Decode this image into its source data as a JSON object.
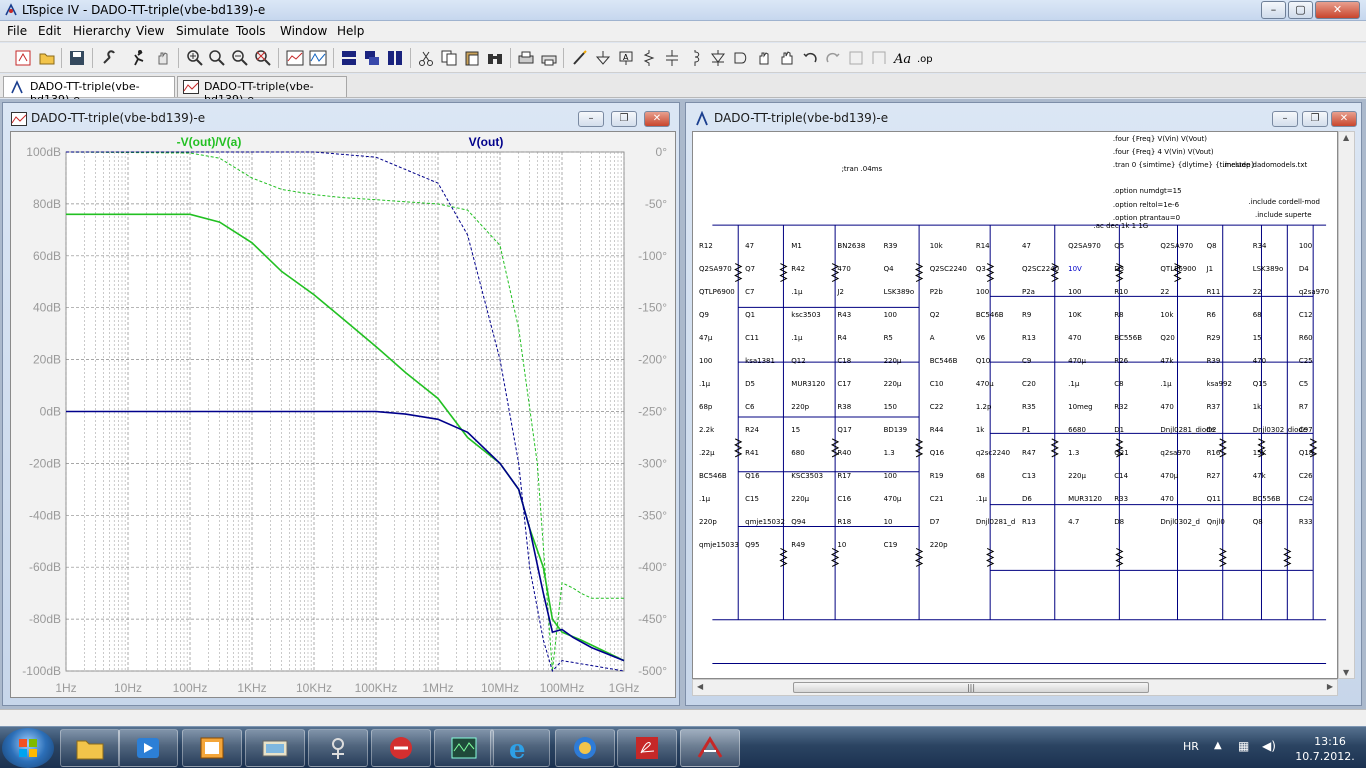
{
  "app": {
    "title": "LTspice IV - DADO-TT-triple(vbe-bd139)-e"
  },
  "menu": [
    "File",
    "Edit",
    "Hierarchy",
    "View",
    "Simulate",
    "Tools",
    "Window",
    "Help"
  ],
  "doc_tabs": [
    {
      "label": "DADO-TT-triple(vbe-bd139)-e",
      "kind": "schematic",
      "active": true
    },
    {
      "label": "DADO-TT-triple(vbe-bd139)-e",
      "kind": "waveform",
      "active": false
    }
  ],
  "waveform_window": {
    "title": "DADO-TT-triple(vbe-bd139)-e",
    "traces": [
      {
        "label": "-V(out)/V(a)",
        "color": "#22c022"
      },
      {
        "label": "V(out)",
        "color": "#00008b"
      }
    ]
  },
  "schematic_window": {
    "title": "DADO-TT-triple(vbe-bd139)-e",
    "directives": [
      ".four {Freq} V(Vin) V(Vout)",
      ".four {Freq} 4 V(Vin) V(Vout)",
      ".tran 0 {simtime} {dlytime} {timestep}",
      ".include dadomodels.txt",
      ".option numdgt=15",
      ".option reltol=1e-6",
      ".option ptrantau=0",
      ".include cordell-mod",
      ".include superte",
      ";tran .04ms",
      ".ac dec 1k 1 1G"
    ],
    "labels": [
      "R12",
      "47",
      "M1",
      "BN2638",
      "R39",
      "10k",
      "R14",
      "47",
      "Q2SA970",
      "Q5",
      "Q2SA970",
      "Q8",
      "R34",
      "100",
      "Q2SA970",
      "Q7",
      "R42",
      "470",
      "Q4",
      "Q2SC2240",
      "Q3",
      "Q2SC2240",
      "10V",
      "D3",
      "QTLP6900",
      "J1",
      "LSK389o",
      "D4",
      "QTLP6900",
      "C7",
      ".1µ",
      "J2",
      "LSK389o",
      "P2b",
      "100",
      "P2a",
      "100",
      "R10",
      "22",
      "R11",
      "22",
      "q2sa970",
      "Q9",
      "Q1",
      "ksc3503",
      "R43",
      "100",
      "Q2",
      "BC546B",
      "R9",
      "10K",
      "R8",
      "10k",
      "R6",
      "68",
      "C12",
      "47µ",
      "C11",
      ".1µ",
      "R4",
      "R5",
      "A",
      "V6",
      "R13",
      "470",
      "BC556B",
      "Q20",
      "R29",
      "15",
      "R60",
      "100",
      "ksa1381",
      "Q12",
      "C18",
      "220µ",
      "BC546B",
      "Q10",
      "C9",
      "470µ",
      "R26",
      "47k",
      "R39",
      "470",
      "C25",
      ".1µ",
      "D5",
      "MUR3120",
      "C17",
      "220µ",
      "C10",
      "470µ",
      "C20",
      ".1µ",
      "C8",
      ".1µ",
      "ksa992",
      "Q15",
      "C5",
      "68p",
      "C6",
      "220p",
      "R38",
      "150",
      "C22",
      "1.2p",
      "R35",
      "10meg",
      "R32",
      "470",
      "R37",
      "1k",
      "R7",
      "2.2k",
      "R24",
      "15",
      "Q17",
      "BD139",
      "R44",
      "1k",
      "P1",
      "6680",
      "D1",
      "Dnjl0281_diode",
      "D2",
      "Dnjl0302_diode",
      "C97",
      ".22µ",
      "R41",
      "680",
      "R40",
      "1.3",
      "Q16",
      "q2sc2240",
      "R47",
      "1.3",
      "Q21",
      "q2sa970",
      "R16",
      "15K",
      "Q18",
      "BC546B",
      "Q16",
      "KSC3503",
      "R17",
      "100",
      "R19",
      "68",
      "C13",
      "220µ",
      "C14",
      "470µ",
      "R27",
      "47k",
      "C26",
      ".1µ",
      "C15",
      "220µ",
      "C16",
      "470µ",
      "C21",
      ".1µ",
      "D6",
      "MUR3120",
      "R33",
      "470",
      "Q11",
      "BC556B",
      "C24",
      "220p",
      "qmje15032",
      "Q94",
      "R18",
      "10",
      "D7",
      "Dnjl0281_d",
      "R13",
      "4.7",
      "D8",
      "Dnjl0302_d",
      "Qnjl0",
      "Q8",
      "R33",
      "qmje15033",
      "Q95",
      "R49",
      "10",
      "C19",
      "220p"
    ]
  },
  "taskbar": {
    "lang": "HR",
    "time": "13:16",
    "date": "10.7.2012."
  },
  "chart_data": {
    "type": "line",
    "title": "",
    "xlabel": "",
    "ylabel": "",
    "x_scale": "log",
    "x_ticks": [
      "1Hz",
      "10Hz",
      "100Hz",
      "1KHz",
      "10KHz",
      "100KHz",
      "1MHz",
      "10MHz",
      "100MHz",
      "1GHz"
    ],
    "x_tick_values": [
      1,
      10,
      100,
      1000,
      10000,
      100000,
      1000000,
      10000000,
      100000000,
      1000000000
    ],
    "y_left_ticks": [
      "100dB",
      "80dB",
      "60dB",
      "40dB",
      "20dB",
      "0dB",
      "-20dB",
      "-40dB",
      "-60dB",
      "-80dB",
      "-100dB"
    ],
    "y_left_values": [
      100,
      80,
      60,
      40,
      20,
      0,
      -20,
      -40,
      -60,
      -80,
      -100
    ],
    "y_right_ticks": [
      "0°",
      "-50°",
      "-100°",
      "-150°",
      "-200°",
      "-250°",
      "-300°",
      "-350°",
      "-400°",
      "-450°",
      "-500°"
    ],
    "y_right_values": [
      0,
      -50,
      -100,
      -150,
      -200,
      -250,
      -300,
      -350,
      -400,
      -450,
      -500
    ],
    "ylim": [
      -100,
      100
    ],
    "y2lim": [
      -500,
      0
    ],
    "grid": true,
    "series": [
      {
        "name": "-V(out)/V(a)",
        "quantity": "magnitude",
        "unit": "dB",
        "color": "#22c022",
        "style": "solid",
        "x": [
          1,
          100,
          300,
          1000,
          3000,
          10000,
          30000,
          100000,
          300000,
          1000000,
          3000000,
          10000000,
          20000000,
          30000000,
          50000000,
          70000000,
          100000000,
          200000000,
          1000000000
        ],
        "y": [
          76,
          76,
          73,
          65,
          54,
          45,
          35.5,
          25,
          15,
          5,
          -10,
          -20,
          -30,
          -45,
          -60,
          -80,
          -85,
          -88,
          -96
        ]
      },
      {
        "name": "-V(out)/V(a)",
        "quantity": "phase",
        "unit": "deg",
        "color": "#22c022",
        "style": "dashed",
        "x": [
          1,
          100,
          300,
          1000,
          3000,
          10000,
          30000,
          100000,
          300000,
          1000000,
          3000000,
          10000000,
          20000000,
          40000000,
          70000000,
          100000000,
          150000000,
          200000000,
          300000000,
          1000000000
        ],
        "y": [
          0,
          -1,
          -6,
          -25,
          -36,
          -41,
          -44,
          -46,
          -48,
          -50,
          -56,
          -90,
          -170,
          -300,
          -500,
          -415,
          -420,
          -425,
          -430,
          -430
        ]
      },
      {
        "name": "V(out)",
        "quantity": "magnitude",
        "unit": "dB",
        "color": "#00008b",
        "style": "solid",
        "x": [
          1,
          1000,
          100000,
          300000,
          1000000,
          3000000,
          10000000,
          20000000,
          30000000,
          50000000,
          70000000,
          100000000,
          150000000,
          300000000,
          1000000000
        ],
        "y": [
          0,
          0,
          0,
          -1,
          -3,
          -8,
          -20,
          -30,
          -45,
          -70,
          -85,
          -84,
          -87,
          -91,
          -96
        ]
      },
      {
        "name": "V(out)",
        "quantity": "phase",
        "unit": "deg",
        "color": "#00008b",
        "style": "dashed",
        "x": [
          1,
          1000,
          10000,
          100000,
          1000000,
          3000000,
          10000000,
          20000000,
          30000000,
          50000000,
          70000000,
          100000000,
          1000000000
        ],
        "y": [
          0,
          0,
          0,
          -5,
          -30,
          -80,
          -200,
          -300,
          -400,
          -470,
          -500,
          -490,
          -500
        ]
      }
    ]
  }
}
